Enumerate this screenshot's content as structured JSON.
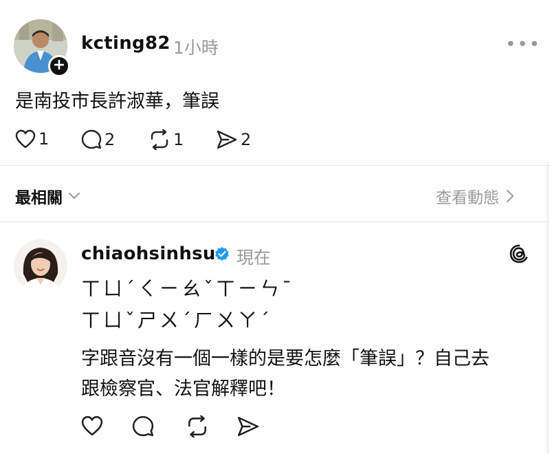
{
  "post": {
    "username": "kcting82",
    "time": "1小時",
    "more_icon": "more-horizontal-icon",
    "content": "是南投市長許淑華，筆誤",
    "actions": {
      "like_count": "1",
      "comment_count": "2",
      "repost_count": "1",
      "share_count": "2"
    }
  },
  "replies_header": {
    "sort_label": "最相關",
    "activity_link": "查看動態"
  },
  "reply": {
    "username": "chiaohsinhsu",
    "verified": true,
    "time": "現在",
    "zhuyin_line1": "ㄒㄩˊㄑㄧㄠˇㄒㄧㄣˉ",
    "zhuyin_line2": "ㄒㄩˇㄕㄨˊㄏㄨㄚˊ",
    "text_line1": "字跟音沒有一個一樣的是要怎麼「筆誤」？自己去",
    "text_line2": "跟檢察官、法官解釋吧！"
  },
  "colors": {
    "verified_blue": "#1d9bf0",
    "muted_gray": "#9a9a9a",
    "divider": "#e5e5e5"
  }
}
